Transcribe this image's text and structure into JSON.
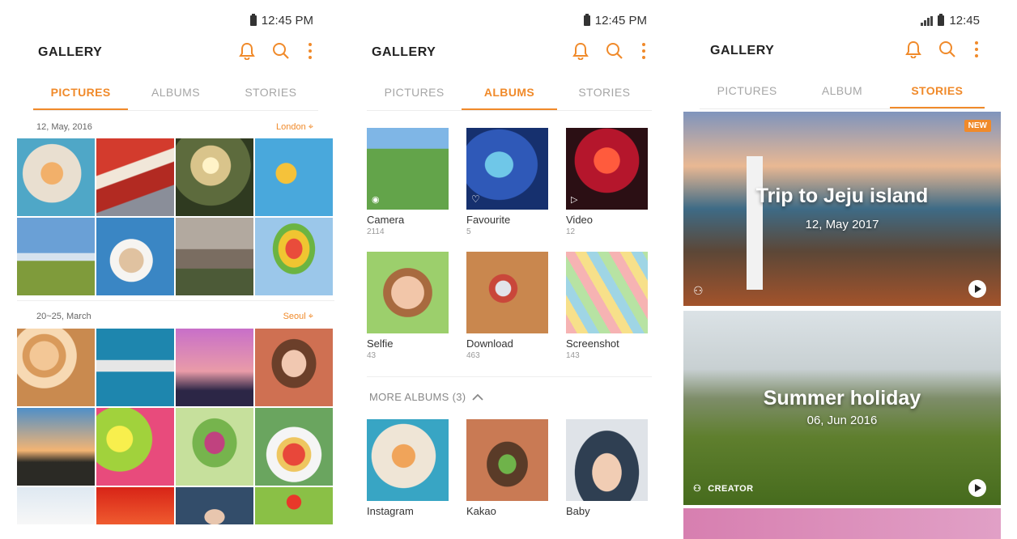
{
  "screens": [
    {
      "status_time": "12:45 PM",
      "app_title": "GALLERY",
      "tabs": [
        "PICTURES",
        "ALBUMS",
        "STORIES"
      ],
      "active_tab": "PICTURES",
      "groups": [
        {
          "date": "12, May, 2016",
          "location": "London"
        },
        {
          "date": "20~25, March",
          "location": "Seoul"
        }
      ]
    },
    {
      "status_time": "12:45 PM",
      "app_title": "GALLERY",
      "tabs": [
        "PICTURES",
        "ALBUMS",
        "STORIES"
      ],
      "active_tab": "ALBUMS",
      "albums": [
        {
          "name": "Camera",
          "count": "2114"
        },
        {
          "name": "Favourite",
          "count": "5"
        },
        {
          "name": "Video",
          "count": "12"
        },
        {
          "name": "Selfie",
          "count": "43"
        },
        {
          "name": "Download",
          "count": "463"
        },
        {
          "name": "Screenshot",
          "count": "143"
        }
      ],
      "more_albums_label": "MORE ALBUMS (3)",
      "more_albums": [
        {
          "name": "Instagram"
        },
        {
          "name": "Kakao"
        },
        {
          "name": "Baby"
        }
      ]
    },
    {
      "status_time": "12:45",
      "app_title": "GALLERY",
      "tabs": [
        "PICTURES",
        "ALBUM",
        "STORIES"
      ],
      "active_tab": "STORIES",
      "stories": [
        {
          "title": "Trip to Jeju island",
          "date": "12, May 2017",
          "badge": "NEW"
        },
        {
          "title": "Summer holiday",
          "date": "06, Jun 2016",
          "creator_label": "CREATOR"
        }
      ]
    }
  ],
  "accent_color": "#f08a2a",
  "icons": [
    "bell-icon",
    "search-icon",
    "more-vert-icon",
    "location-pin-icon",
    "play-icon"
  ]
}
